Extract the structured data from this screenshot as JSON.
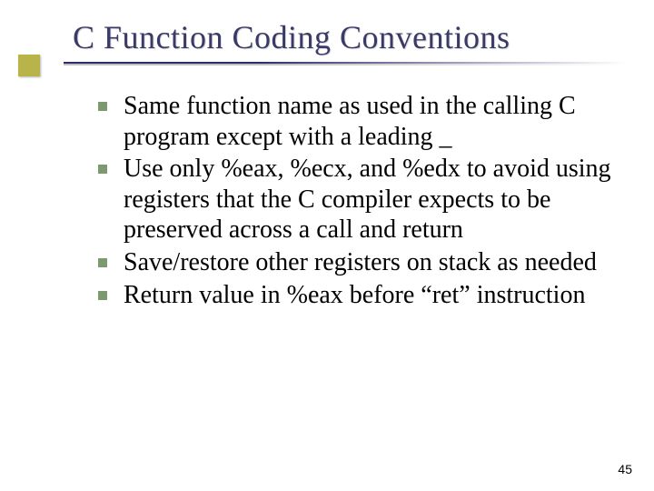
{
  "slide": {
    "title": "C Function Coding Conventions",
    "bullets": [
      "Same function name as used in the calling C program except with a leading _",
      "Use only %eax, %ecx, and %edx to avoid using registers that the C compiler expects to be preserved across a call and return",
      "Save/restore other registers on stack as needed",
      "Return value in %eax before “ret” instruction"
    ],
    "page_number": "45"
  }
}
